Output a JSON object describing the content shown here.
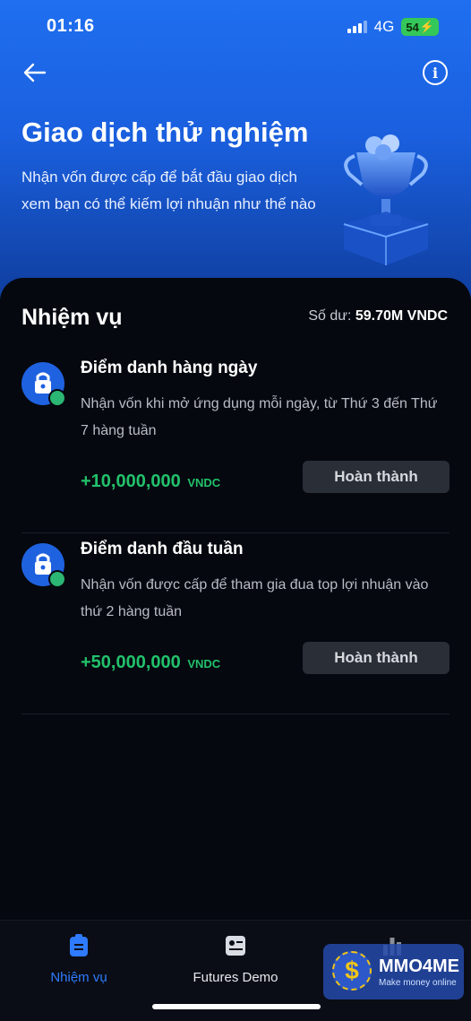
{
  "status": {
    "time": "01:16",
    "network": "4G",
    "battery": "54"
  },
  "header": {
    "title": "Giao dịch thử nghiệm",
    "subtitle": "Nhận vốn được cấp để bắt đầu giao dịch xem bạn có thể kiếm lợi nhuận như thế nào"
  },
  "tasks_section": {
    "title": "Nhiệm vụ",
    "balance_label": "Số dư:",
    "balance_value": "59.70M VNDC",
    "items": [
      {
        "title": "Điểm danh hàng ngày",
        "description": "Nhận vốn khi mở ứng dụng mỗi ngày, từ Thứ 3 đến Thứ 7 hàng tuần",
        "reward": "+10,000,000",
        "unit": "VNDC",
        "button": "Hoàn thành"
      },
      {
        "title": "Điểm danh đầu tuần",
        "description": "Nhận vốn được cấp để tham gia đua top lợi nhuận vào thứ 2 hàng tuần",
        "reward": "+50,000,000",
        "unit": "VNDC",
        "button": "Hoàn thành"
      }
    ]
  },
  "bottom_nav": [
    {
      "label": "Nhiệm vụ",
      "icon": "task-clipboard-icon",
      "active": true
    },
    {
      "label": "Futures Demo",
      "icon": "futures-card-icon",
      "active": false
    },
    {
      "label": "",
      "icon": "leaderboard-icon",
      "active": false
    }
  ],
  "watermark": {
    "text": "MMO4ME",
    "sub": "Make money online",
    "symbol": "$"
  },
  "colors": {
    "accent": "#1f6ff0",
    "reward": "#22c16b",
    "active_tab": "#2f7bff"
  }
}
